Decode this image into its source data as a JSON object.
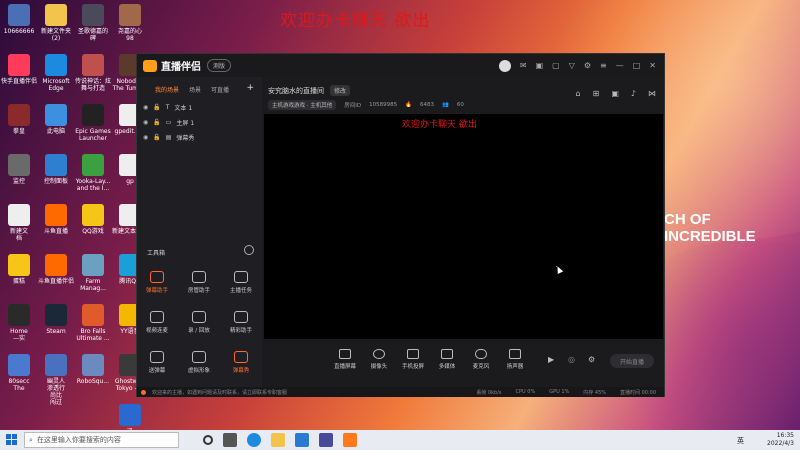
{
  "overlay_title": "欢迎办卡聊天 欲出",
  "background_text": "CH OF INCREDIBLE",
  "desktop_icons": [
    {
      "label": "10666666",
      "color": "#4a6fb5"
    },
    {
      "label": "新建文件夹\n(2)",
      "color": "#f3c44c"
    },
    {
      "label": "圣歌德嘉的\n碑",
      "color": "#4a4a5a"
    },
    {
      "label": "尧嘉的心\n98",
      "color": "#a06a4a"
    },
    {
      "label": "快手直播伴侣",
      "color": "#ff3b5c"
    },
    {
      "label": "Microsoft\nEdge",
      "color": "#1b8adf"
    },
    {
      "label": "传说神话：炫\n舞与打造",
      "color": "#c0504d"
    },
    {
      "label": "Nobody -\nThe Tuma...",
      "color": "#5a3a2a"
    },
    {
      "label": "拳皇",
      "color": "#8a2a2a"
    },
    {
      "label": "此电脑",
      "color": "#3d8fe0"
    },
    {
      "label": "Epic Games\nLauncher",
      "color": "#222222"
    },
    {
      "label": "gpedit.bat",
      "color": "#eeeeee"
    },
    {
      "label": "监控",
      "color": "#6a6a6a"
    },
    {
      "label": "控制面板",
      "color": "#2f7fd0"
    },
    {
      "label": "Yooka-Lay...\nand the I...",
      "color": "#3aa040"
    },
    {
      "label": "gp",
      "color": "#eeeeee"
    },
    {
      "label": "新建文\n档",
      "color": "#eeeeee"
    },
    {
      "label": "斗鱼直播",
      "color": "#ff6a00"
    },
    {
      "label": "QQ游戏",
      "color": "#f5c518"
    },
    {
      "label": "新建文本文档",
      "color": "#eeeeee"
    },
    {
      "label": "蛋糕",
      "color": "#f5c518"
    },
    {
      "label": "斗鱼直播伴侣",
      "color": "#ff6a00"
    },
    {
      "label": "Farm\nManag...",
      "color": "#6aa0c0"
    },
    {
      "label": "腾讯QQ",
      "color": "#1a9fd8"
    },
    {
      "label": "Home\n—实",
      "color": "#2a2a2a"
    },
    {
      "label": "Steam",
      "color": "#1b2838"
    },
    {
      "label": "Bro Falls\nUltimate ...",
      "color": "#e05a2a"
    },
    {
      "label": "YY语音",
      "color": "#f5b800"
    },
    {
      "label": "80secc\nThe",
      "color": "#4a7ad0"
    },
    {
      "label": "幽灵人\n渗透行\n尚比\n闯过",
      "color": "#4a70c0"
    },
    {
      "label": "RoboSqu...",
      "color": "#6a8ac0"
    },
    {
      "label": "Ghostwire\nTokyo - ...",
      "color": "#3a3a3a"
    },
    {
      "label": "迅",
      "color": "#2a6ad0"
    }
  ],
  "taskbar": {
    "search_placeholder": "在这里输入你要搜索的内容",
    "time": "16:35",
    "date": "2022/4/3",
    "lang": "英"
  },
  "app": {
    "name": "直播伴侣",
    "version_pill": "测版",
    "tabs": [
      "我的场景",
      "场景",
      "可直播"
    ],
    "layers": [
      {
        "name": "文本 1"
      },
      {
        "name": "主屏 1"
      },
      {
        "name": "弹幕秀"
      }
    ],
    "tools_heading": "工具箱",
    "tools": [
      {
        "label": "弹幕助手",
        "hot": true
      },
      {
        "label": "房管助手",
        "hot": false
      },
      {
        "label": "主播任务",
        "hot": false
      },
      {
        "label": "视频连麦",
        "hot": false
      },
      {
        "label": "录 / 回放",
        "hot": false
      },
      {
        "label": "精彩助手",
        "hot": false
      },
      {
        "label": "送弹幕",
        "hot": false
      },
      {
        "label": "虚拟形象",
        "hot": false
      },
      {
        "label": "弹幕秀",
        "hot": true
      }
    ],
    "room_title": "安究脑水的直播间",
    "edit_label": "修改",
    "category": "主机游戏游戏 · 主机其他",
    "room_id_label": "房间ID",
    "room_id": "10589985",
    "hot_count": "6483",
    "fans_count": "60",
    "preview_overlay": "欢迎办卡聊天 欲出",
    "bottom_tools": [
      "直播屏幕",
      "摄像头",
      "手机投屏",
      "多媒体",
      "麦克风",
      "扬声器"
    ],
    "start_live": "开始直播",
    "status_message": "欢迎来的主播，如遇到问题请及时联系，请立即联系专职客服",
    "metrics": [
      "丢帧 0kb/s",
      "CPU 0%",
      "GPU 1%",
      "内存 45%",
      "直播时间 00:00"
    ]
  }
}
